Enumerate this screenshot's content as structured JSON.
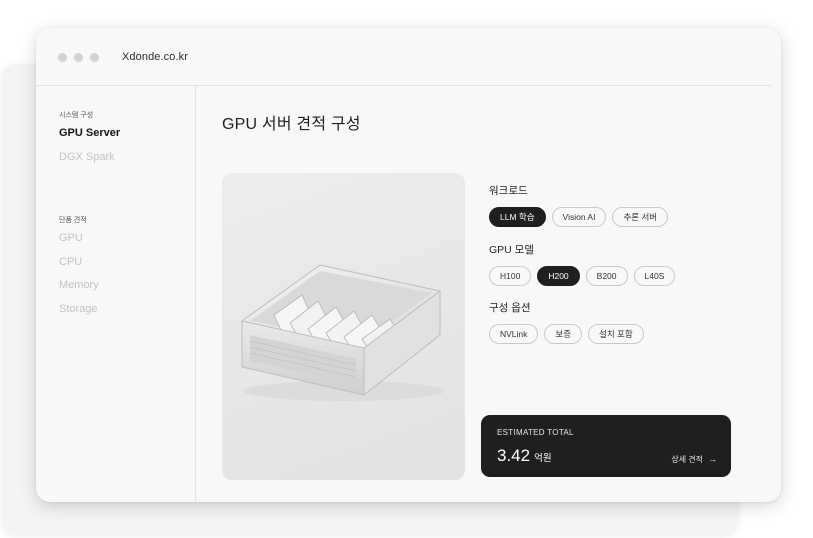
{
  "browser": {
    "url": "Xdonde.co.kr"
  },
  "sidebar": {
    "system_caption": "시스템 구성",
    "system_items": [
      {
        "label": "GPU Server",
        "active": true
      },
      {
        "label": "DGX Spark",
        "active": false
      }
    ],
    "single_caption": "단품 견적",
    "single_items": [
      {
        "label": "GPU"
      },
      {
        "label": "CPU"
      },
      {
        "label": "Memory"
      },
      {
        "label": "Storage"
      }
    ]
  },
  "main": {
    "title": "GPU 서버 견적 구성",
    "workload": {
      "label": "워크로드",
      "options": [
        "LLM 학습",
        "Vision AI",
        "추론 서버"
      ],
      "selected": "LLM 학습"
    },
    "gpu_model": {
      "label": "GPU 모델",
      "options": [
        "H100",
        "H200",
        "B200",
        "L40S"
      ],
      "selected": "H200"
    },
    "config": {
      "label": "구성 옵션",
      "options": [
        "NVLink",
        "보증",
        "설치 포함"
      ]
    },
    "total": {
      "caption": "ESTIMATED TOTAL",
      "amount": "3.42",
      "unit": "억원",
      "link": "상세 견적"
    }
  }
}
